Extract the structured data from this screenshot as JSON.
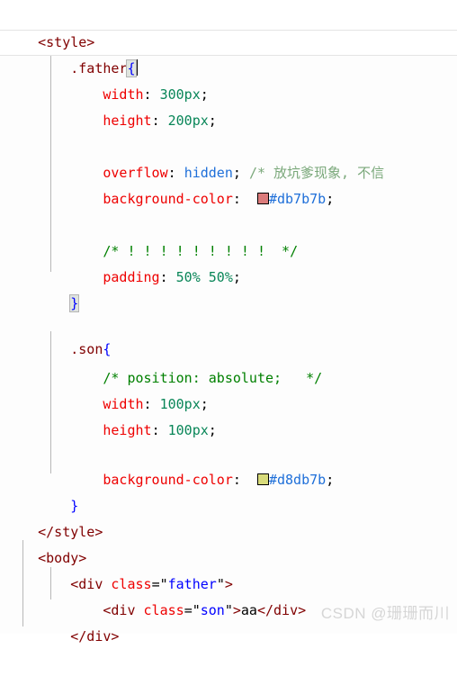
{
  "editor": {
    "language": "html-css",
    "theme": "light",
    "colors": {
      "background": "#ffffff",
      "tag": "#800000",
      "selector": "#800000",
      "brace": "#0000ff",
      "property": "#ee0000",
      "value": "#098658",
      "keyword": "#1e6fd9",
      "hex_literal": "#1e6fd9",
      "comment": "#008000",
      "comment_cjk": "#7aa87a",
      "attribute": "#ee0000",
      "attribute_value": "#0000ff",
      "plain_text": "#000000",
      "indent_guide": "#b8b8b8",
      "current_line_border": "#e4e4e4",
      "brace_match_bg": "#dfe4df",
      "brace_match_border": "#b4b4b4",
      "watermark": "#d6d6d6"
    },
    "caret_visible": true,
    "current_line_index": 1
  },
  "code": {
    "line_01": {
      "tag_open": "<style>"
    },
    "line_02": {
      "selector": ".father",
      "brace": "{"
    },
    "line_03": {
      "prop": "width",
      "colon": ": ",
      "value": "300px",
      "semi": ";"
    },
    "line_04": {
      "prop": "height",
      "colon": ": ",
      "value": "200px",
      "semi": ";"
    },
    "line_06": {
      "prop": "overflow",
      "colon": ": ",
      "keyword": "hidden",
      "semi": ";",
      "comment": "/* 放坑爹现象, 不信"
    },
    "line_07": {
      "prop": "background-color",
      "colon": ": ",
      "swatch_color": "#db7b7b",
      "hex": "#db7b7b",
      "semi": ";"
    },
    "line_09": {
      "comment": "/* ! ! ! ! ! ! ! ! !  */"
    },
    "line_10": {
      "prop": "padding",
      "colon": ": ",
      "value": "50% 50%",
      "semi": ";"
    },
    "line_11": {
      "brace": "}"
    },
    "line_13": {
      "selector": ".son",
      "brace": "{"
    },
    "line_14": {
      "comment": "/* position: absolute;   */"
    },
    "line_15": {
      "prop": "width",
      "colon": ": ",
      "value": "100px",
      "semi": ";"
    },
    "line_16": {
      "prop": "height",
      "colon": ": ",
      "value": "100px",
      "semi": ";"
    },
    "line_18": {
      "prop": "background-color",
      "colon": ": ",
      "swatch_color": "#d8db7b",
      "hex": "#d8db7b",
      "semi": ";"
    },
    "line_19": {
      "brace": "}"
    },
    "line_20": {
      "tag_close": "</style>"
    },
    "line_21": {
      "tag_open": "<body>"
    },
    "line_22": {
      "lt": "<",
      "tagname": "div",
      "space": " ",
      "attr": "class",
      "eq": "=",
      "q1": "\"",
      "value": "father",
      "q2": "\"",
      "gt": ">"
    },
    "line_23": {
      "lt": "<",
      "tagname": "div",
      "space": " ",
      "attr": "class",
      "eq": "=",
      "q1": "\"",
      "value": "son",
      "q2": "\"",
      "gt": ">",
      "text": "aa",
      "close": "</div>"
    },
    "line_24": {
      "tag_close": "</div>"
    }
  },
  "watermark": {
    "text": "CSDN @珊珊而川"
  }
}
